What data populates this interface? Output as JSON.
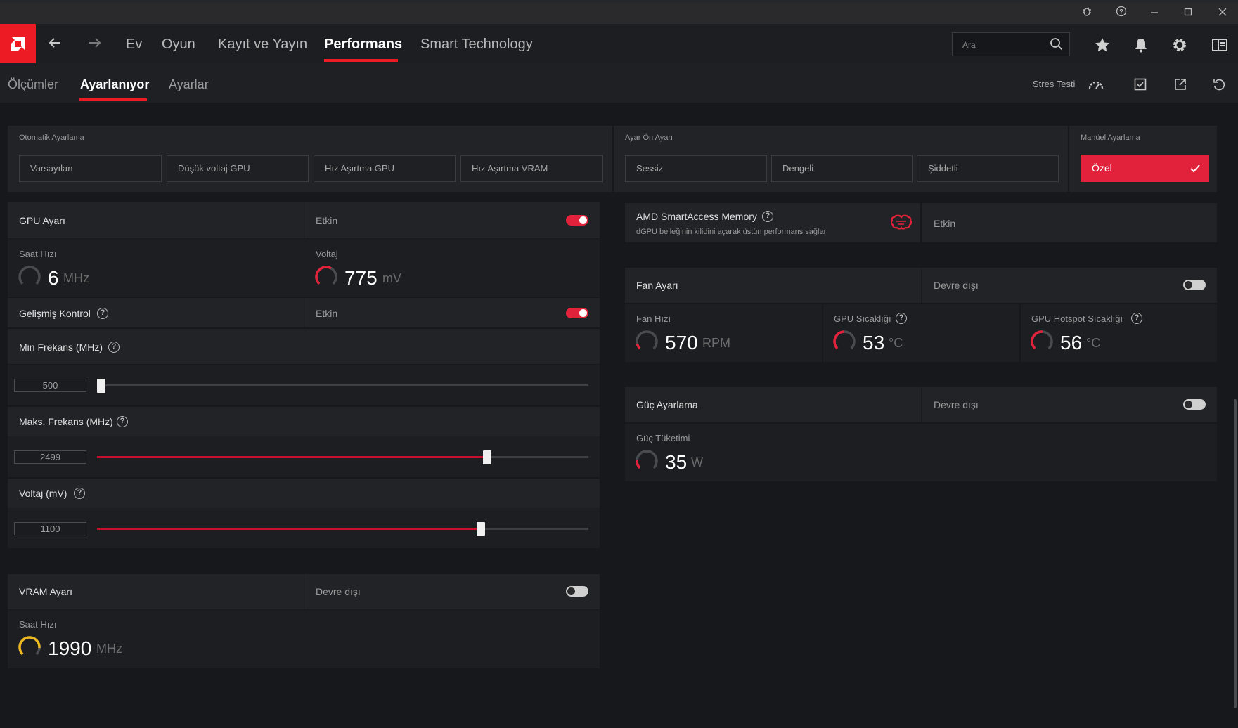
{
  "colors": {
    "accent": "#e2223b",
    "brand_red": "#ed1c24",
    "background": "#17181c",
    "gauge_yellow": "#f0b820"
  },
  "window": {
    "controls": [
      "bug-icon",
      "help-icon",
      "minimize-icon",
      "maximize-icon",
      "close-icon"
    ]
  },
  "nav": {
    "tabs": [
      {
        "label": "Ev"
      },
      {
        "label": "Oyun"
      },
      {
        "label": "Kayıt ve Yayın"
      },
      {
        "label": "Performans",
        "active": true
      },
      {
        "label": "Smart Technology"
      }
    ],
    "search_placeholder": "Ara",
    "right_icons": [
      "star-icon",
      "bell-icon",
      "gear-icon",
      "layout-icon"
    ]
  },
  "subnav": {
    "tabs": [
      {
        "label": "Ölçümler"
      },
      {
        "label": "Ayarlanıyor",
        "active": true
      },
      {
        "label": "Ayarlar"
      }
    ],
    "stress_test_label": "Stres Testi",
    "icons": [
      "gauge-icon",
      "save-profile-icon",
      "export-icon",
      "reset-icon"
    ]
  },
  "auto_tuning": {
    "label": "Otomatik Ayarlama",
    "buttons": [
      "Varsayılan",
      "Düşük voltaj GPU",
      "Hız Aşırtma GPU",
      "Hız Aşırtma VRAM"
    ]
  },
  "tuning_preset": {
    "label": "Ayar Ön Ayarı",
    "buttons": [
      "Sessiz",
      "Dengeli",
      "Şiddetli"
    ]
  },
  "manual_tuning": {
    "label": "Manüel Ayarlama",
    "button": "Özel",
    "selected": true
  },
  "gpu_tuning": {
    "title": "GPU Ayarı",
    "status": "Etkin",
    "enabled": true,
    "clock": {
      "label": "Saat Hızı",
      "value": "6",
      "unit": "MHz"
    },
    "voltage": {
      "label": "Voltaj",
      "value": "775",
      "unit": "mV"
    }
  },
  "advanced_control": {
    "title": "Gelişmiş Kontrol",
    "status": "Etkin",
    "enabled": true,
    "min_freq": {
      "label": "Min Frekans (MHz)",
      "value": "500",
      "fraction": 0.0
    },
    "max_freq": {
      "label": "Maks. Frekans (MHz)",
      "value": "2499",
      "fraction": 0.79
    },
    "voltage": {
      "label": "Voltaj (mV)",
      "value": "1100",
      "fraction": 0.78
    }
  },
  "vram_tuning": {
    "title": "VRAM Ayarı",
    "status": "Devre dışı",
    "enabled": false,
    "clock": {
      "label": "Saat Hızı",
      "value": "1990",
      "unit": "MHz"
    }
  },
  "sam": {
    "title": "AMD SmartAccess Memory",
    "description": "dGPU belleğinin kilidini açarak üstün performans sağlar",
    "status": "Etkin"
  },
  "fan_tuning": {
    "title": "Fan Ayarı",
    "status": "Devre dışı",
    "enabled": false,
    "fan_speed": {
      "label": "Fan Hızı",
      "value": "570",
      "unit": "RPM"
    },
    "gpu_temp": {
      "label": "GPU Sıcaklığı",
      "value": "53",
      "unit": "°C"
    },
    "hotspot_temp": {
      "label": "GPU Hotspot Sıcaklığı",
      "value": "56",
      "unit": "°C"
    }
  },
  "power_tuning": {
    "title": "Güç Ayarlama",
    "status": "Devre dışı",
    "enabled": false,
    "power": {
      "label": "Güç Tüketimi",
      "value": "35",
      "unit": "W"
    }
  }
}
